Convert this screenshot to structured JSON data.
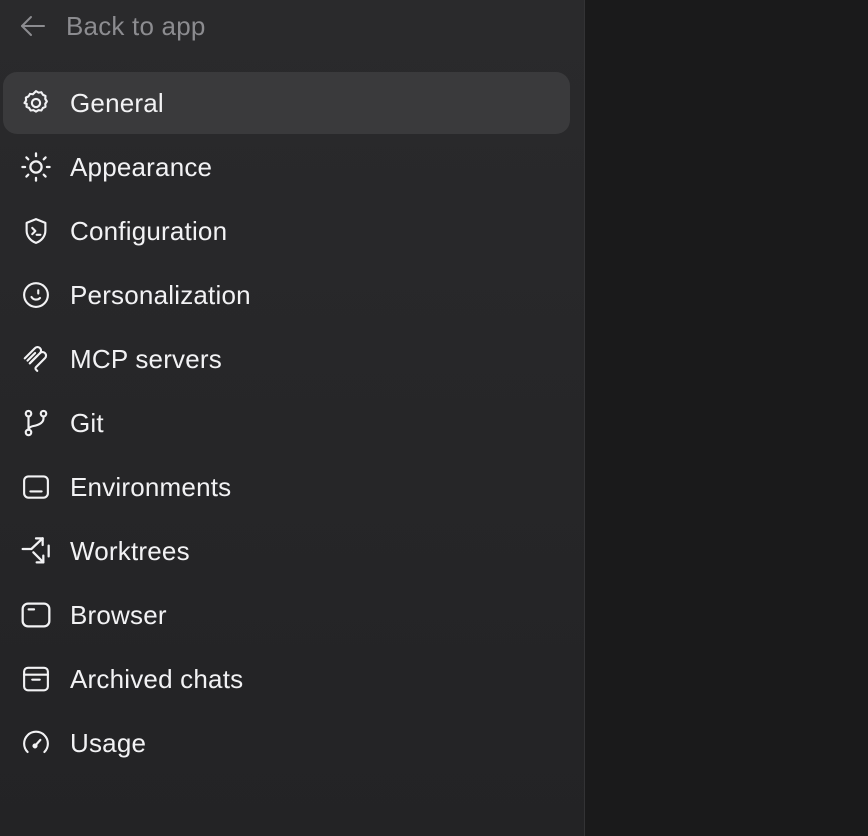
{
  "sidebar": {
    "back_label": "Back to app",
    "items": [
      {
        "label": "General",
        "icon": "gear-icon",
        "active": true
      },
      {
        "label": "Appearance",
        "icon": "sun-icon",
        "active": false
      },
      {
        "label": "Configuration",
        "icon": "shield-terminal-icon",
        "active": false
      },
      {
        "label": "Personalization",
        "icon": "smile-icon",
        "active": false
      },
      {
        "label": "MCP servers",
        "icon": "mcp-icon",
        "active": false
      },
      {
        "label": "Git",
        "icon": "git-branch-icon",
        "active": false
      },
      {
        "label": "Environments",
        "icon": "monitor-icon",
        "active": false
      },
      {
        "label": "Worktrees",
        "icon": "worktree-arrows-icon",
        "active": false
      },
      {
        "label": "Browser",
        "icon": "browser-window-icon",
        "active": false
      },
      {
        "label": "Archived chats",
        "icon": "archive-box-icon",
        "active": false
      },
      {
        "label": "Usage",
        "icon": "speedometer-icon",
        "active": false
      }
    ]
  },
  "colors": {
    "sidebar_bg": "#2a2a2c",
    "main_bg": "#1a1a1b",
    "active_item_bg": "#3a3a3c",
    "text_primary": "#f2f2f4",
    "text_muted": "#8c8c90"
  }
}
